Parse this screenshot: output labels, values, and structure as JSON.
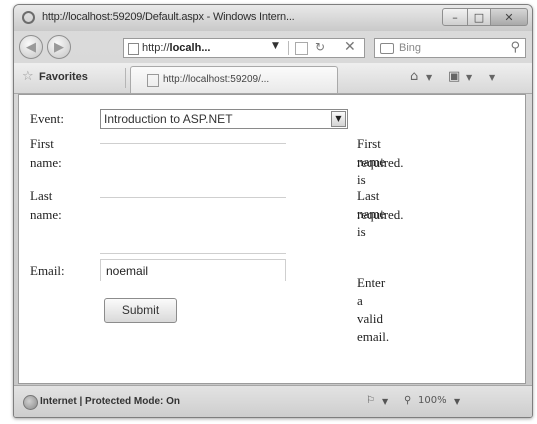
{
  "window": {
    "title": "http://localhost:59209/Default.aspx - Windows Intern...",
    "caption_min": "–",
    "caption_max": "□",
    "caption_close": "✕"
  },
  "navbar": {
    "address_prefix": "http://",
    "address_bold": "localh...",
    "search_placeholder": "Bing"
  },
  "favorites": {
    "label": "Favorites",
    "tab_label": "http://localhost:59209/..."
  },
  "form": {
    "event_label": "Event:",
    "event_selected": "Introduction to ASP.NET",
    "first_name_label_1": "First",
    "first_name_label_2": "name:",
    "first_name_error_1": "First name is",
    "first_name_error_2": "required.",
    "last_name_label_1": "Last",
    "last_name_label_2": "name:",
    "last_name_error_1": "Last name is",
    "last_name_error_2": "required.",
    "email_label": "Email:",
    "email_value": "noemail",
    "email_error": "Enter a valid email.",
    "submit_label": "Submit"
  },
  "status": {
    "zone_text": "Internet | Protected Mode: On",
    "zoom": "100%"
  }
}
